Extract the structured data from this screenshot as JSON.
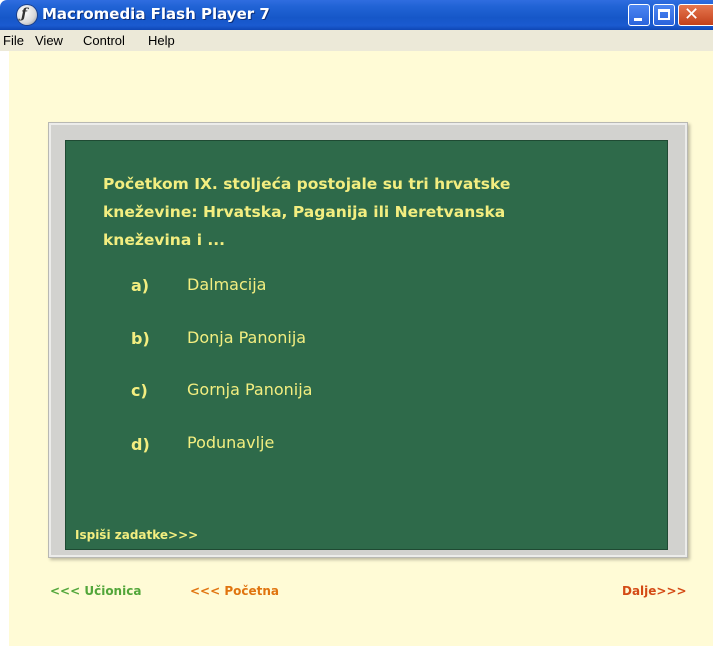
{
  "window": {
    "title": "Macromedia Flash Player 7",
    "controls": [
      "minimize",
      "maximize",
      "close"
    ]
  },
  "menu": {
    "items": [
      "File",
      "View",
      "Control",
      "Help"
    ]
  },
  "quiz": {
    "question": "Početkom IX. stoljeća postojale su tri hrvatske kneževine: Hrvatska, Paganija ili Neretvanska kneževina i ...",
    "question_lines": [
      "Početkom IX. stoljeća postojale su tri hrvatske",
      "kneževine: Hrvatska, Paganija ili Neretvanska",
      "kneževina i ..."
    ],
    "options": [
      {
        "letter": "a)",
        "text": "Dalmacija"
      },
      {
        "letter": "b)",
        "text": "Donja Panonija"
      },
      {
        "letter": "c)",
        "text": "Gornja Panonija"
      },
      {
        "letter": "d)",
        "text": "Podunavlje"
      }
    ],
    "print_link": "Ispiši zadatke>>>"
  },
  "nav": {
    "ucionica": "<<< Učionica",
    "pocetna": "<<< Početna",
    "dalje": "Dalje>>>"
  },
  "colors": {
    "titlebar": "#1657c8",
    "board": "#2e6a4a",
    "chalk_text": "#f3ee80",
    "stage_bg": "#fffbd6",
    "nav_green": "#52a63a",
    "nav_orange": "#e0740f",
    "nav_red": "#d44a15"
  },
  "icons": {
    "app": "flash-player-icon",
    "minimize": "minimize-icon",
    "maximize": "maximize-icon",
    "close": "close-icon"
  }
}
